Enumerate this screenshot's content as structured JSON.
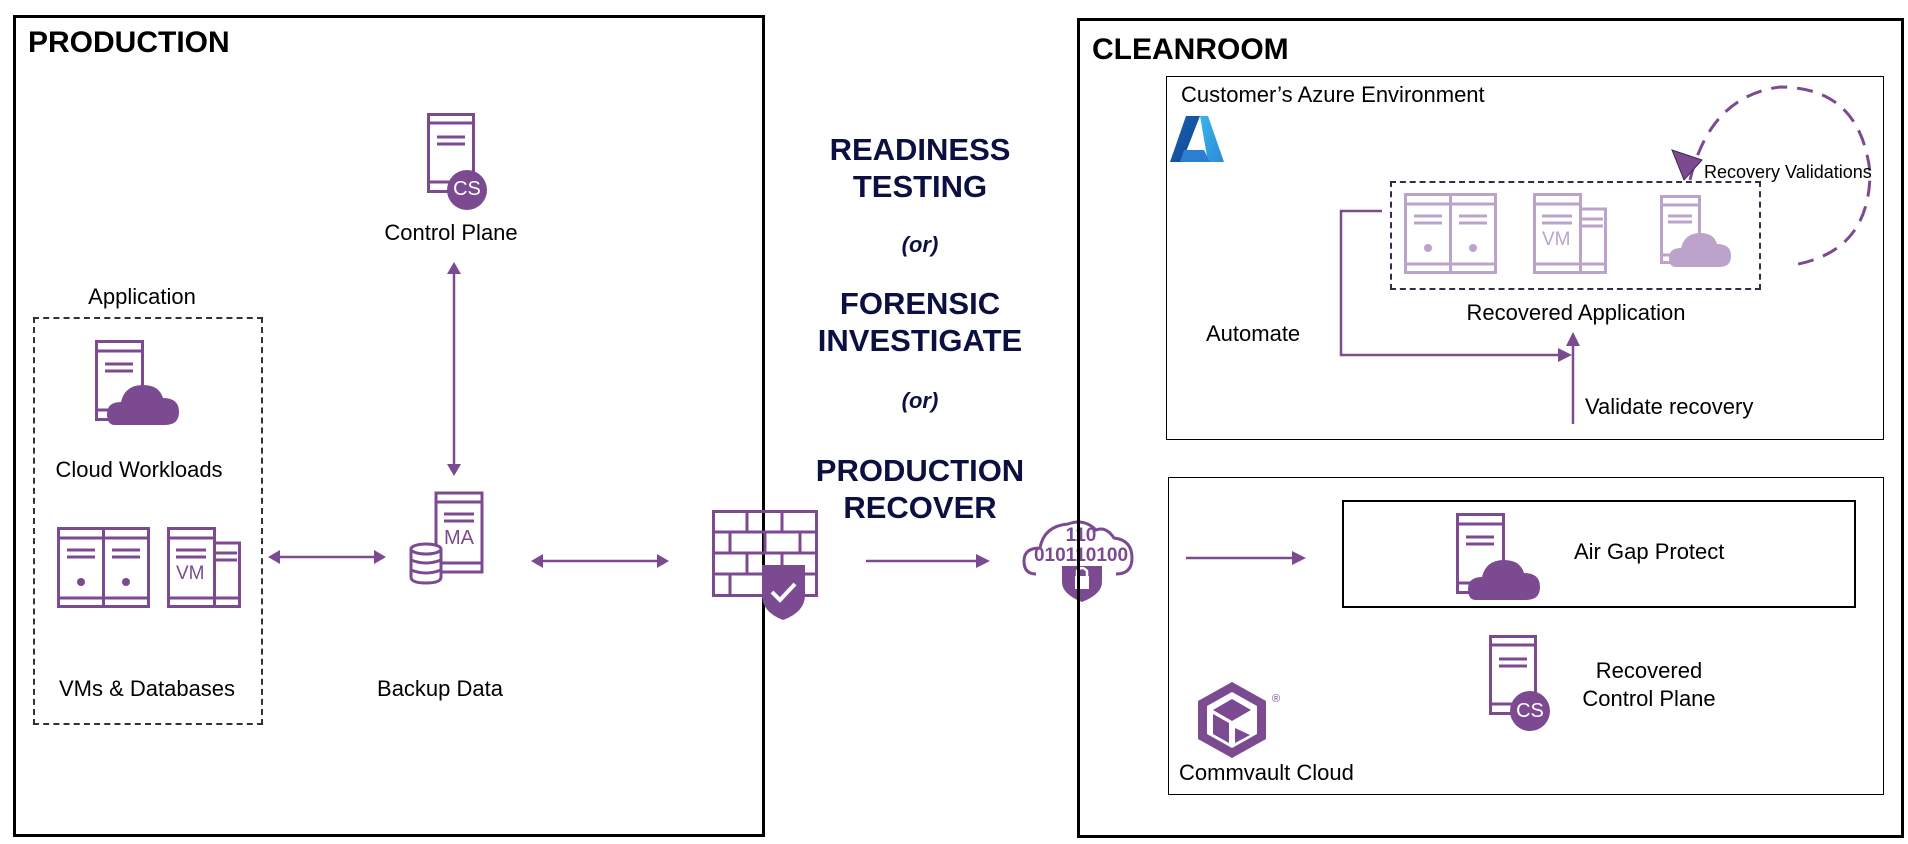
{
  "production": {
    "title": "PRODUCTION",
    "control_plane_label": "Control Plane",
    "control_plane_badge": "CS",
    "application_label": "Application",
    "cloud_workloads_label": "Cloud Workloads",
    "vms_databases_label": "VMs & Databases",
    "vm_badge": "VM",
    "backup_data_label": "Backup Data",
    "ma_badge": "MA"
  },
  "middle": {
    "option1": "READINESS\nTESTING",
    "or1": "(or)",
    "option2": "FORENSIC\nINVESTIGATE",
    "or2": "(or)",
    "option3": "PRODUCTION\nRECOVER",
    "binary_top": "110",
    "binary_bottom": "010110100"
  },
  "cleanroom": {
    "title": "CLEANROOM",
    "azure": {
      "title": "Customer’s Azure Environment",
      "recovery_validations_label": "Recovery Validations",
      "recovered_application_label": "Recovered Application",
      "vm_badge": "VM",
      "automate_label": "Automate",
      "validate_label": "Validate recovery"
    },
    "commvault": {
      "air_gap_label": "Air Gap Protect",
      "recovered_control_plane_label": "Recovered\nControl Plane",
      "cs_badge": "CS",
      "brand_label": "Commvault Cloud",
      "registered_mark": "®"
    }
  },
  "colors": {
    "purple": "#7b4a91",
    "light_purple": "#bba3cc",
    "navy": "#0b1040"
  }
}
